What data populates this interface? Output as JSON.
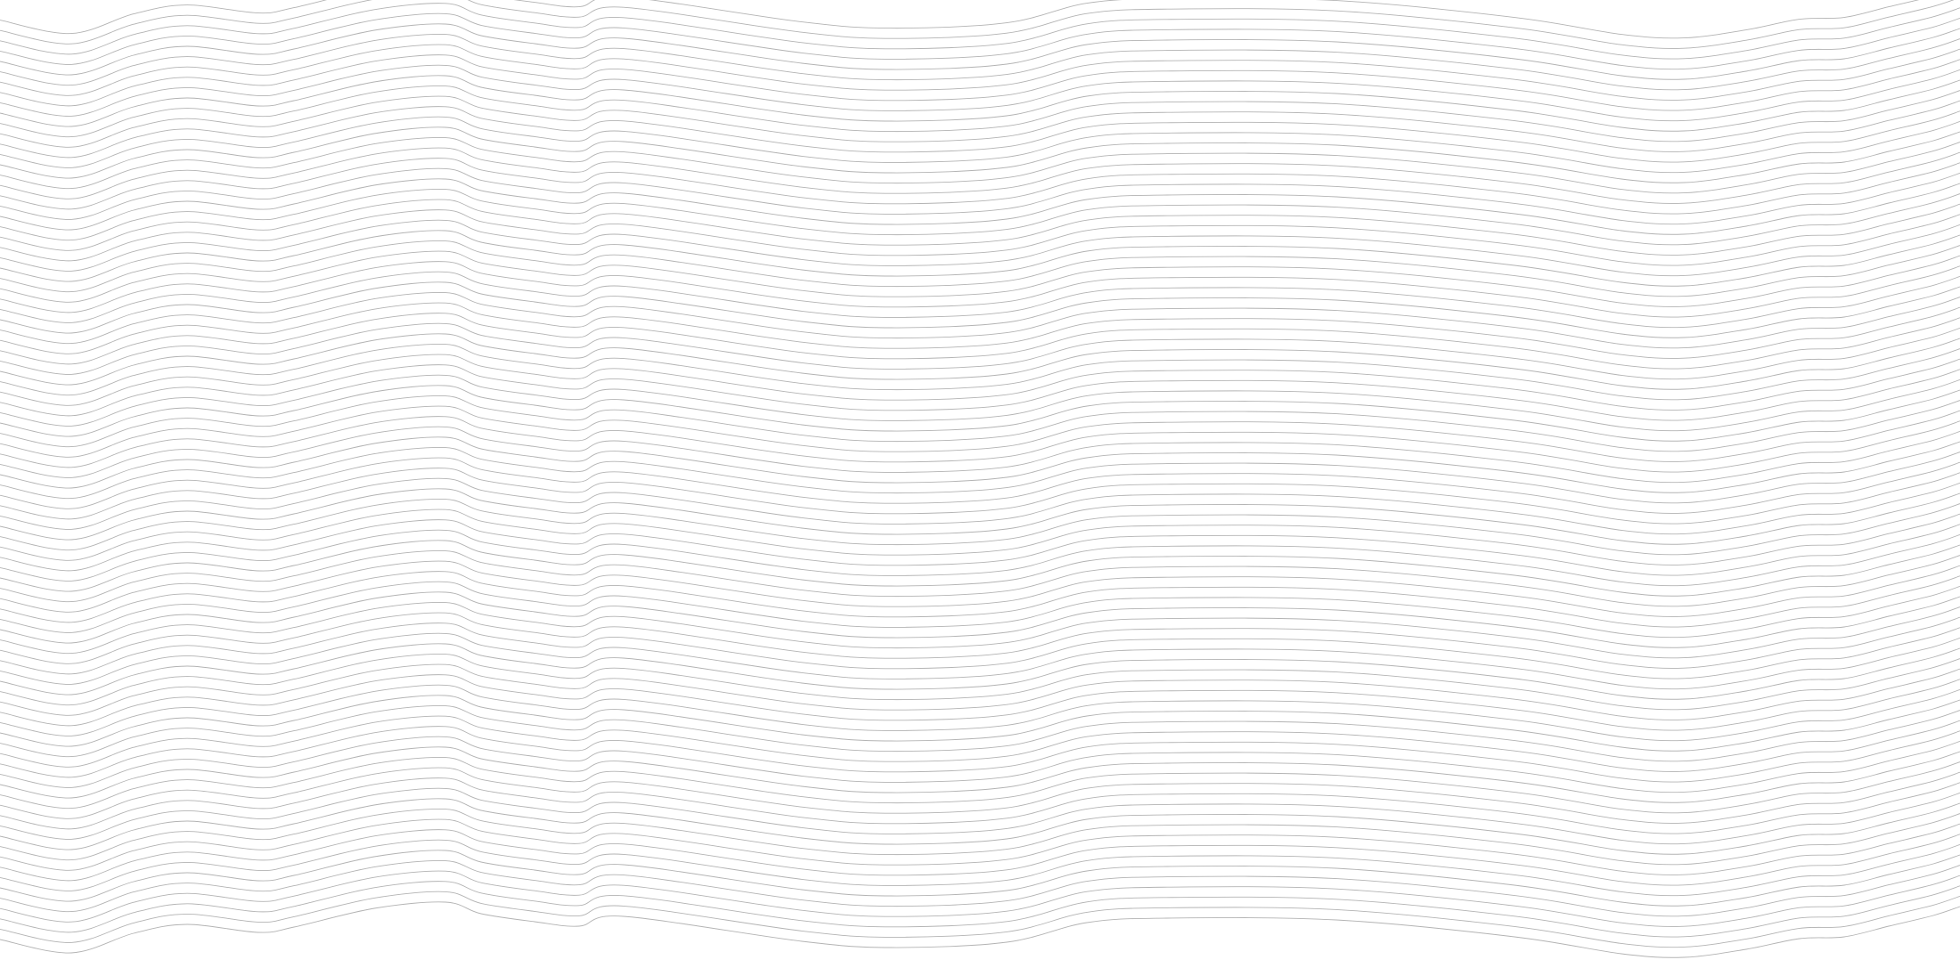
{
  "background": {
    "pattern": "wavy-line-texture",
    "background_color": "#ffffff",
    "line_color": "#b3b3b3",
    "line_count": 90
  }
}
